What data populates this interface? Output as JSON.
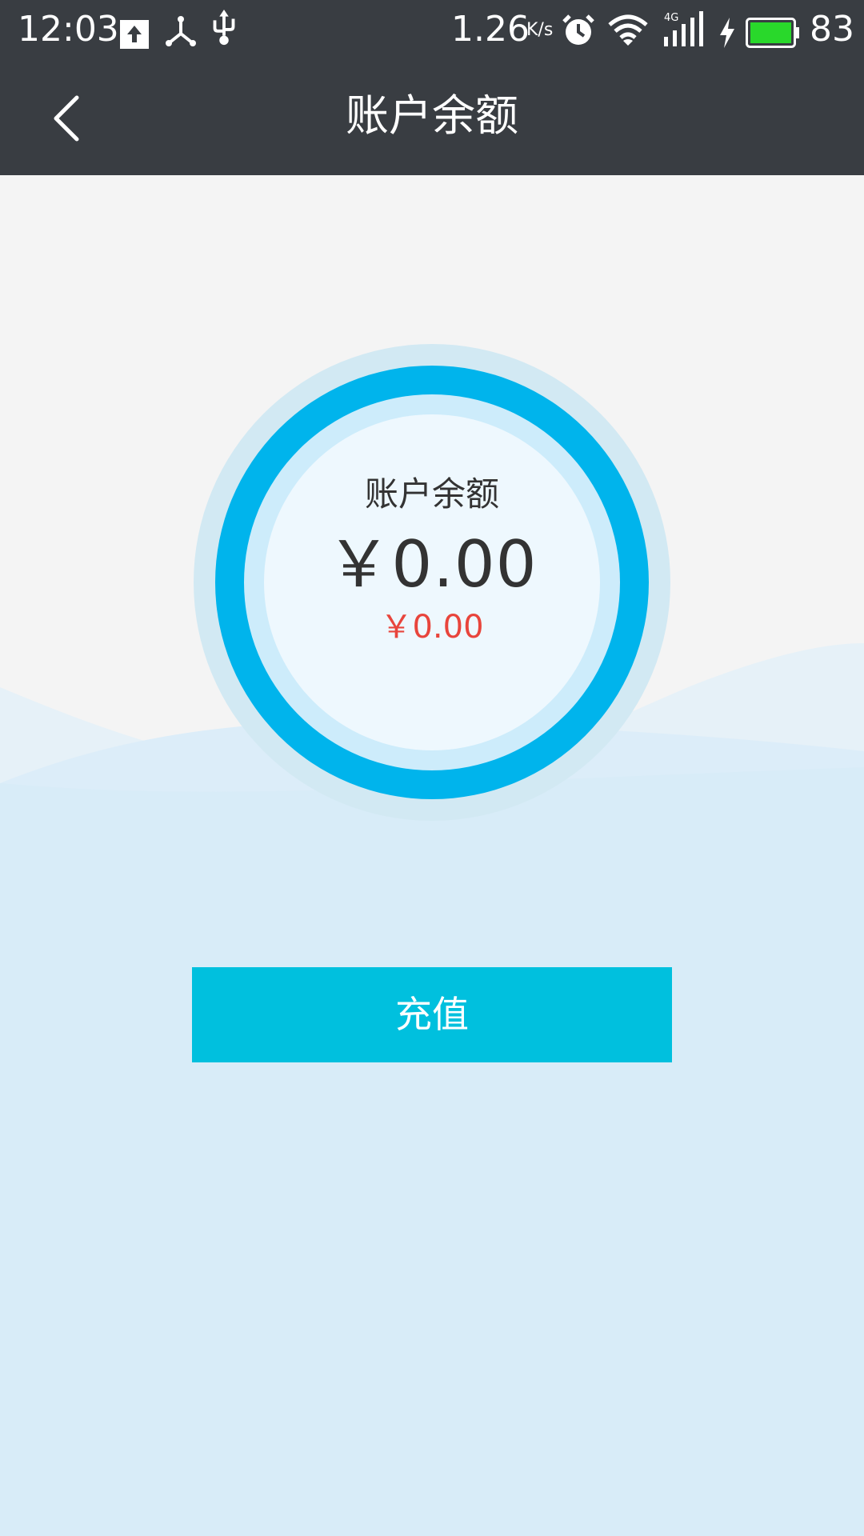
{
  "status_bar": {
    "time": "12:03",
    "net_speed": "1.26",
    "net_speed_unit": "K/s",
    "battery_percent": "83",
    "icons": [
      "upload-icon",
      "share-hub-icon",
      "usb-icon",
      "alarm-icon",
      "wifi-icon",
      "signal-4g-icon",
      "charging-icon",
      "battery-icon"
    ],
    "battery_color": "#29d82b"
  },
  "app_bar": {
    "title": "账户余额",
    "back_icon": "chevron-left-icon"
  },
  "balance": {
    "label": "账户余额",
    "amount": "￥0.00",
    "sub_amount": "￥0.00"
  },
  "actions": {
    "recharge_label": "充值"
  },
  "colors": {
    "header_bg": "#393d42",
    "page_bg": "#f4f4f4",
    "wave_bg": "#d8ecf8",
    "ring": "#00b4ec",
    "button": "#00c0de",
    "sub_amount": "#e8453c"
  }
}
